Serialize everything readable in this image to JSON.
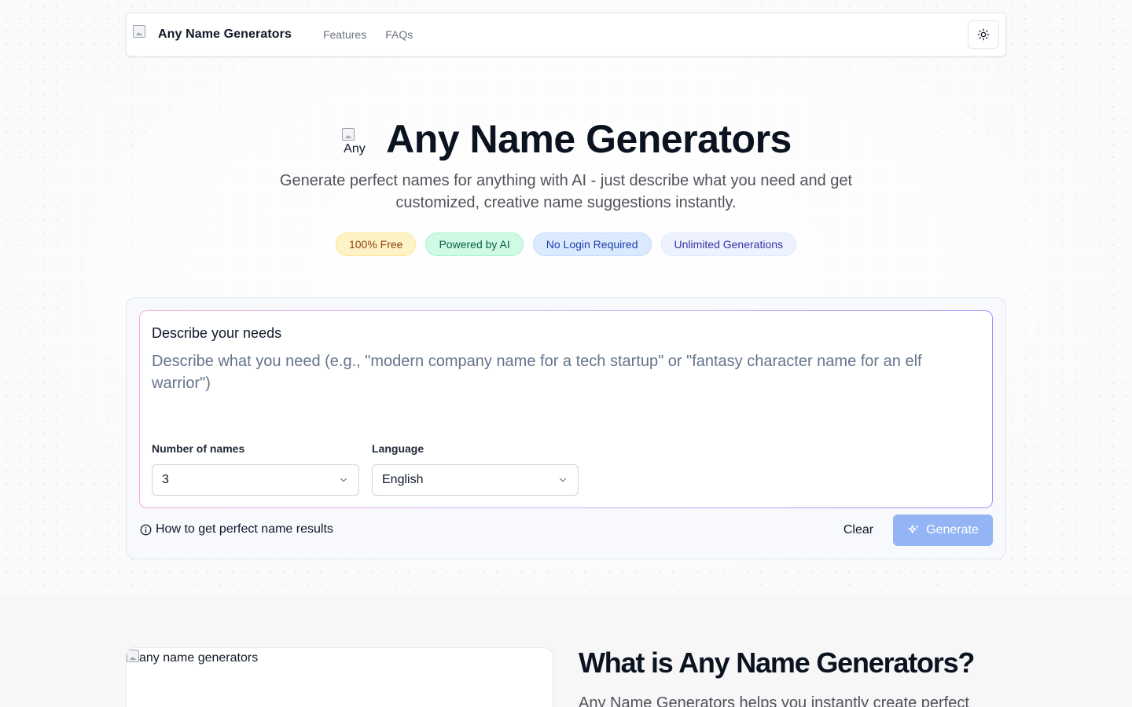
{
  "nav": {
    "logo_alt": "",
    "brand": "Any Name Generators",
    "links": [
      "Features",
      "FAQs"
    ],
    "theme_icon": "sun-icon"
  },
  "hero": {
    "logo_alt": "Any",
    "title": "Any Name Generators",
    "subtitle": "Generate perfect names for anything with AI - just describe what you need and get customized, creative name suggestions instantly.",
    "badges": [
      "100% Free",
      "Powered by AI",
      "No Login Required",
      "Unlimited Generations"
    ]
  },
  "generator": {
    "needs_label": "Describe your needs",
    "needs_placeholder": "Describe what you need (e.g., \"modern company name for a tech startup\" or \"fantasy character name for an elf warrior\")",
    "needs_value": "",
    "count_label": "Number of names",
    "count_value": "3",
    "language_label": "Language",
    "language_value": "English",
    "tips_label": "How to get perfect name results",
    "clear_label": "Clear",
    "generate_label": "Generate"
  },
  "about": {
    "image_alt": "any name generators",
    "title": "What is Any Name Generators?",
    "text": "Any Name Generators helps you instantly create perfect"
  },
  "colors": {
    "primary_button": "#93b4f5",
    "badge_free_bg": "#fef3c7",
    "badge_ai_bg": "#d1fae5",
    "badge_login_bg": "#dbeafe",
    "badge_unlimited_bg": "#eef2ff"
  }
}
